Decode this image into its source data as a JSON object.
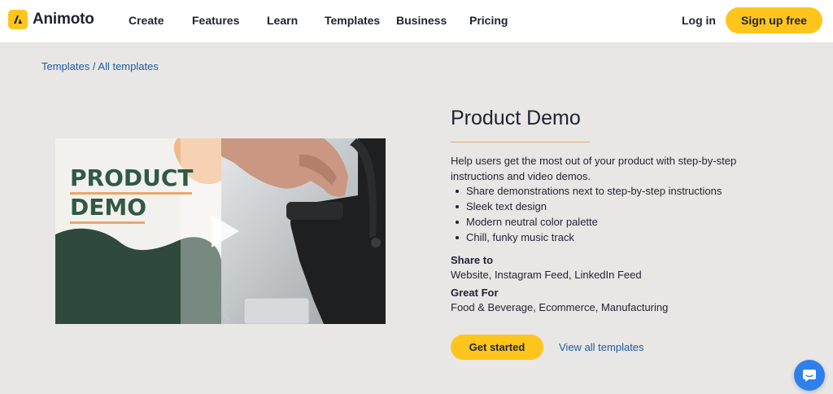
{
  "header": {
    "logo_text": "Animoto",
    "nav": [
      "Create",
      "Features",
      "Learn",
      "Templates",
      "Business",
      "Pricing"
    ],
    "login": "Log in",
    "signup": "Sign up free"
  },
  "breadcrumb": {
    "templates": "Templates",
    "separator": "/",
    "all_templates": "All templates"
  },
  "thumbnail": {
    "line1": "PRODUCT",
    "line2": "DEMO"
  },
  "template": {
    "title": "Product Demo",
    "description": "Help users get the most out of your product with step-by-step instructions and video demos.",
    "bullets": [
      "Share demonstrations next to step-by-step instructions",
      "Sleek text design",
      "Modern neutral color palette",
      "Chill, funky music track"
    ],
    "share_to_label": "Share to",
    "share_to_value": "Website, Instagram Feed, LinkedIn Feed",
    "great_for_label": "Great For",
    "great_for_value": "Food & Beverage, Ecommerce, Manufacturing",
    "get_started": "Get started",
    "view_all": "View all templates"
  },
  "colors": {
    "accent": "#ffc51c",
    "link": "#1f5aa6",
    "background": "#e9e7e5",
    "thumbnail_green": "#2f4a3c",
    "thumbnail_orange": "#f2b98b",
    "chat": "#2f80ed"
  },
  "icons": {
    "logo": "animoto-logo-icon",
    "play": "play-icon",
    "chat": "chat-bubble-icon"
  }
}
